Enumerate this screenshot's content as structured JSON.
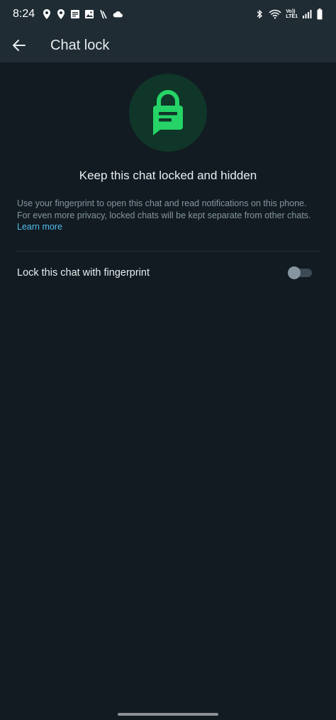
{
  "status_bar": {
    "time": "8:24",
    "left_icons": [
      "location-icon",
      "location-icon",
      "notes-icon",
      "gallery-icon",
      "activity-icon",
      "cloud-icon"
    ],
    "right_icons": [
      "bluetooth-icon",
      "wifi-icon",
      "volte-icon",
      "signal-icon",
      "battery-icon"
    ],
    "volte_line1": "Vo))",
    "volte_line2": "LTE1"
  },
  "app_bar": {
    "title": "Chat lock",
    "back_icon": "arrow-left-icon"
  },
  "hero": {
    "icon": "locked-chat-icon",
    "accent": "#25d366",
    "circle_bg": "#103529"
  },
  "content": {
    "headline": "Keep this chat locked and hidden",
    "description": "Use your fingerprint to open this chat and read notifications on this phone. For even more privacy, locked chats will be kept separate from other chats.",
    "learn_more": "Learn more",
    "link_color": "#53bdeb"
  },
  "setting": {
    "label": "Lock this chat with fingerprint",
    "enabled": false
  },
  "colors": {
    "background": "#121b22",
    "bar": "#1f2c34"
  }
}
